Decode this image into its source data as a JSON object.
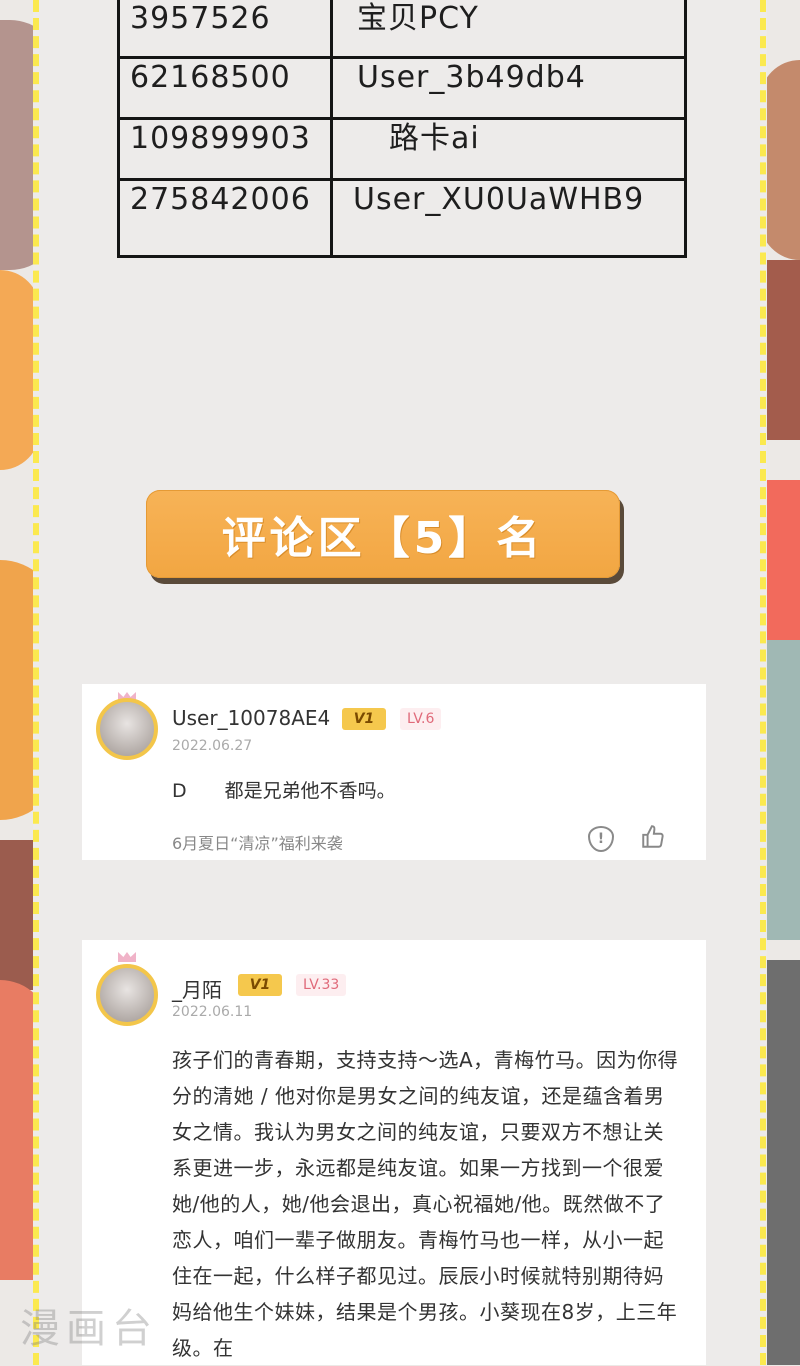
{
  "winners": {
    "rows": [
      {
        "id": "3957526",
        "name": "宝贝PCY"
      },
      {
        "id": "62168500",
        "name": "User_3b49db4"
      },
      {
        "id": "109899903",
        "name": "路卡ai"
      },
      {
        "id": "275842006",
        "name": "User_XU0UaWHB9"
      }
    ]
  },
  "banner": {
    "label": "评论区【5】名"
  },
  "comments": [
    {
      "username": "User_10078AE4",
      "vip_badge": "V1",
      "level": "LV.6",
      "date": "2022.06.27",
      "text": "D　　都是兄弟他不香吗。",
      "activity": "6月夏日“清凉”福利来袭"
    },
    {
      "username": "_月陌",
      "vip_badge": "V1",
      "level": "LV.33",
      "date": "2022.06.11",
      "text": "孩子们的青春期，支持支持～选A，青梅竹马。因为你得分的清她 / 他对你是男女之间的纯友谊，还是蕴含着男女之情。我认为男女之间的纯友谊，只要双方不想让关系更进一步，永远都是纯友谊。如果一方找到一个很爱她/他的人，她/他会退出，真心祝福她/他。既然做不了恋人，咱们一辈子做朋友。青梅竹马也一样，从小一起住在一起，什么样子都见过。辰辰小时候就特别期待妈妈给他生个妹妹，结果是个男孩。小葵现在8岁，上三年级。在"
    }
  ],
  "watermark": "漫画台",
  "colors": {
    "panel": "#edebea",
    "dash": "#fbe94f",
    "banner": "#f4ab4a",
    "vip": "#f5c84d",
    "level_text": "#e06a7a"
  },
  "icons": {
    "report": "report-icon",
    "like": "thumbs-up-icon"
  }
}
